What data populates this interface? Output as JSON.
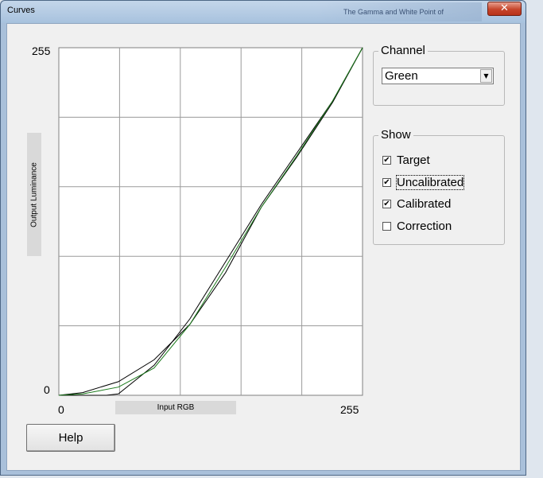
{
  "window": {
    "title": "Curves",
    "background_title": "The Gamma and White Point of"
  },
  "chart_data": {
    "type": "line",
    "title": "",
    "xlabel": "Input RGB",
    "ylabel": "Output Luminance",
    "xlim": [
      0,
      255
    ],
    "ylim": [
      0,
      255
    ],
    "x_tick_labels": [
      "0",
      "255"
    ],
    "y_tick_labels": [
      "0",
      "255"
    ],
    "grid": true,
    "grid_divisions": 5,
    "series": [
      {
        "color": "#000000",
        "points": [
          [
            0,
            0
          ],
          [
            20,
            2
          ],
          [
            50,
            10
          ],
          [
            80,
            26
          ],
          [
            110,
            52
          ],
          [
            140,
            90
          ],
          [
            170,
            138
          ],
          [
            200,
            175
          ],
          [
            230,
            215
          ],
          [
            255,
            255
          ]
        ]
      },
      {
        "color": "#000000",
        "points": [
          [
            0,
            0
          ],
          [
            20,
            0
          ],
          [
            40,
            0
          ],
          [
            50,
            1
          ],
          [
            80,
            22
          ],
          [
            110,
            56
          ],
          [
            140,
            98
          ],
          [
            170,
            140
          ],
          [
            200,
            178
          ],
          [
            230,
            216
          ],
          [
            255,
            255
          ]
        ]
      },
      {
        "color": "#1a7a1a",
        "points": [
          [
            0,
            0
          ],
          [
            20,
            1
          ],
          [
            50,
            6
          ],
          [
            80,
            20
          ],
          [
            110,
            52
          ],
          [
            140,
            94
          ],
          [
            170,
            138
          ],
          [
            200,
            176
          ],
          [
            230,
            216
          ],
          [
            255,
            255
          ]
        ]
      }
    ]
  },
  "channel": {
    "legend": "Channel",
    "value": "Green"
  },
  "show": {
    "legend": "Show",
    "items": [
      {
        "label": "Target",
        "checked": true
      },
      {
        "label": "Uncalibrated",
        "checked": true
      },
      {
        "label": "Calibrated",
        "checked": true
      },
      {
        "label": "Correction",
        "checked": false
      }
    ]
  },
  "buttons": {
    "help": "Help",
    "close": "✕"
  }
}
